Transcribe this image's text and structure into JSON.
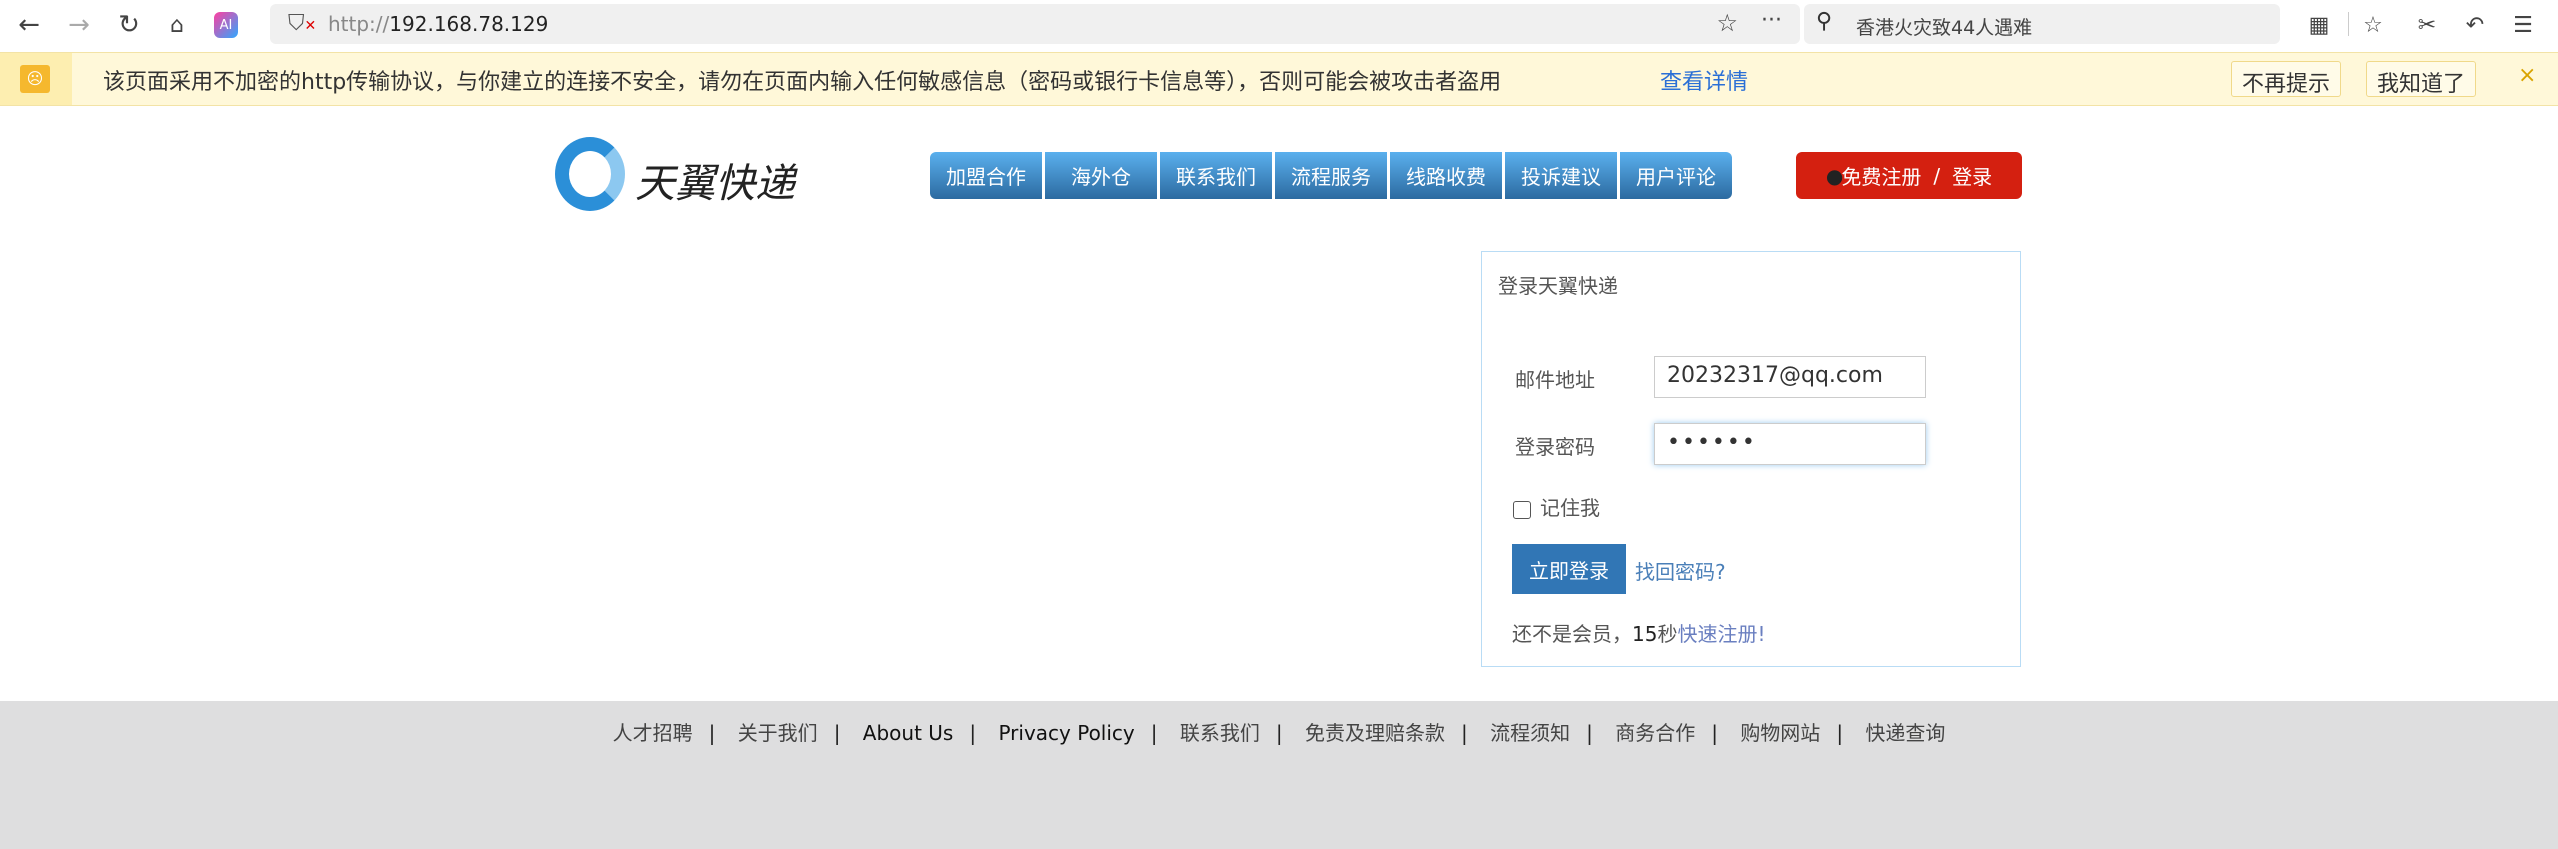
{
  "browser": {
    "url_protocol": "http://",
    "url_host": "192.168.78.129",
    "search_text": "香港火灾致44人遇难",
    "ai_badge": "AI"
  },
  "infobar": {
    "message": "该页面采用不加密的http传输协议，与你建立的连接不安全，请勿在页面内输入任何敏感信息（密码或银行卡信息等），否则可能会被攻击者盗用",
    "details_link": "查看详情",
    "dont_remind": "不再提示",
    "got_it": "我知道了",
    "close": "×"
  },
  "site": {
    "logo_text": "天翼快递",
    "nav": [
      "加盟合作",
      "海外仓",
      "联系我们",
      "流程服务",
      "线路收费",
      "投诉建议",
      "用户评论"
    ],
    "register": "免费注册",
    "slash": "/",
    "login": "登录"
  },
  "login": {
    "title": "登录天翼快递",
    "email_label": "邮件地址",
    "email_value": "20232317@qq.com",
    "password_label": "登录密码",
    "password_value": "••••••",
    "remember": "记住我",
    "submit": "立即登录",
    "forgot": "找回密码?",
    "not_member": "还不是会员，",
    "seconds": "15",
    "seconds_unit": "秒",
    "quick_register": "快速注册",
    "exclaim": "!"
  },
  "footer": {
    "links": [
      "人才招聘",
      "关于我们",
      "About Us",
      "Privacy Policy",
      "联系我们",
      "免责及理赔条款",
      "流程须知",
      "商务合作",
      "购物网站",
      "快递查询"
    ]
  }
}
